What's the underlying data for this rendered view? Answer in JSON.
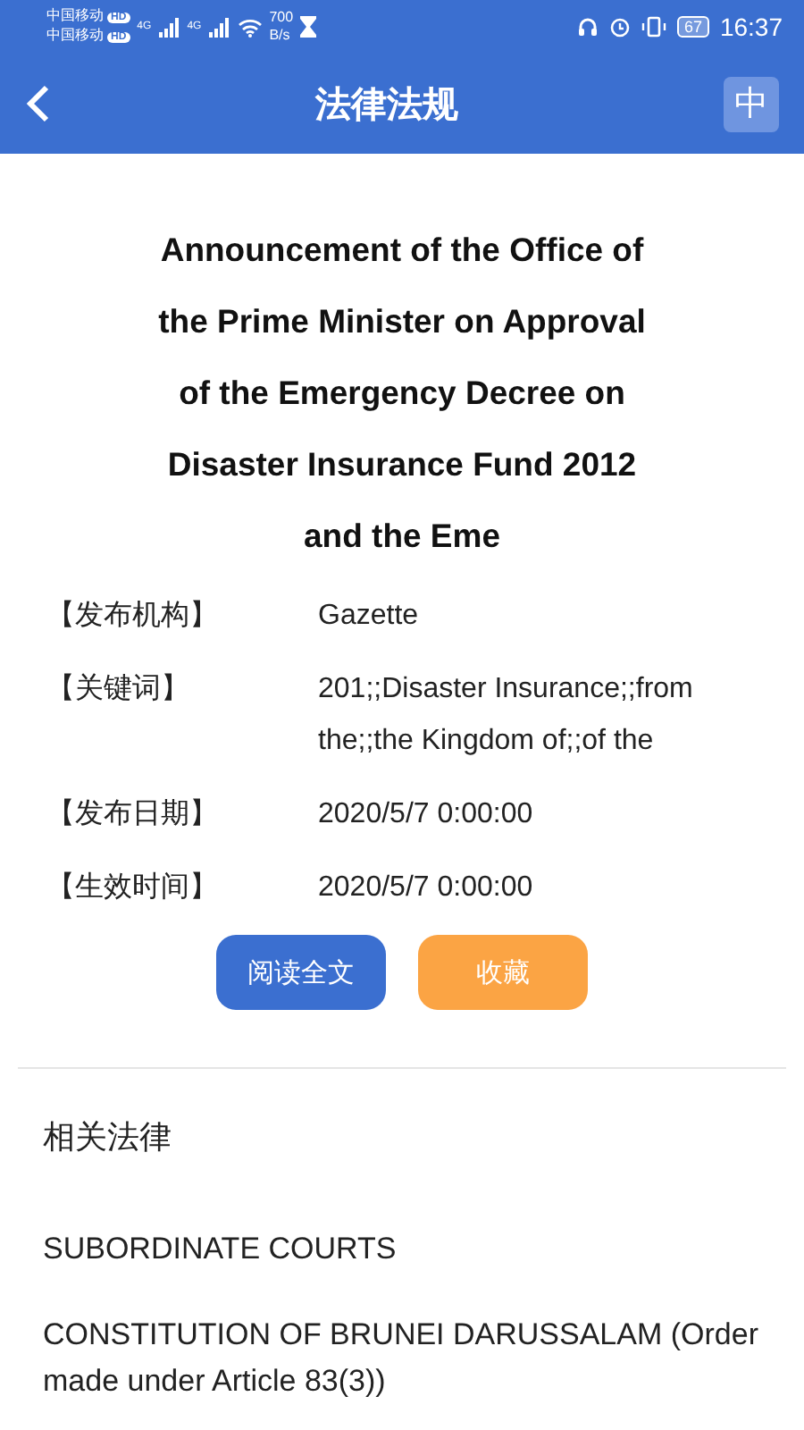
{
  "status_bar": {
    "carriers": [
      "中国移动",
      "中国移动"
    ],
    "hd_badges": [
      "HD",
      "HD"
    ],
    "network": [
      "4G",
      "4G"
    ],
    "speed": [
      "700",
      "B/s"
    ],
    "battery": "67",
    "time": "16:37"
  },
  "header": {
    "title": "法律法规",
    "language_button": "中"
  },
  "document": {
    "title_lines": [
      "Announcement of the Office of",
      "the Prime Minister on Approval",
      "of the Emergency Decree on",
      "Disaster Insurance Fund 2012",
      "and the Eme"
    ],
    "fields": [
      {
        "label": "【发布机构】",
        "value": "Gazette"
      },
      {
        "label": "【关键词】",
        "value": "201;;Disaster Insurance;;from the;;the Kingdom of;;of the"
      },
      {
        "label": "【发布日期】",
        "value": "2020/5/7 0:00:00"
      },
      {
        "label": "【生效时间】",
        "value": "2020/5/7 0:00:00"
      }
    ],
    "buttons": [
      {
        "label": "阅读全文",
        "kind": "primary"
      },
      {
        "label": "收藏",
        "kind": "accent"
      }
    ]
  },
  "related": {
    "heading": "相关法律",
    "items": [
      "SUBORDINATE COURTS",
      "CONSTITUTION OF BRUNEI DARUSSALAM (Order made under Article 83(3))"
    ]
  }
}
